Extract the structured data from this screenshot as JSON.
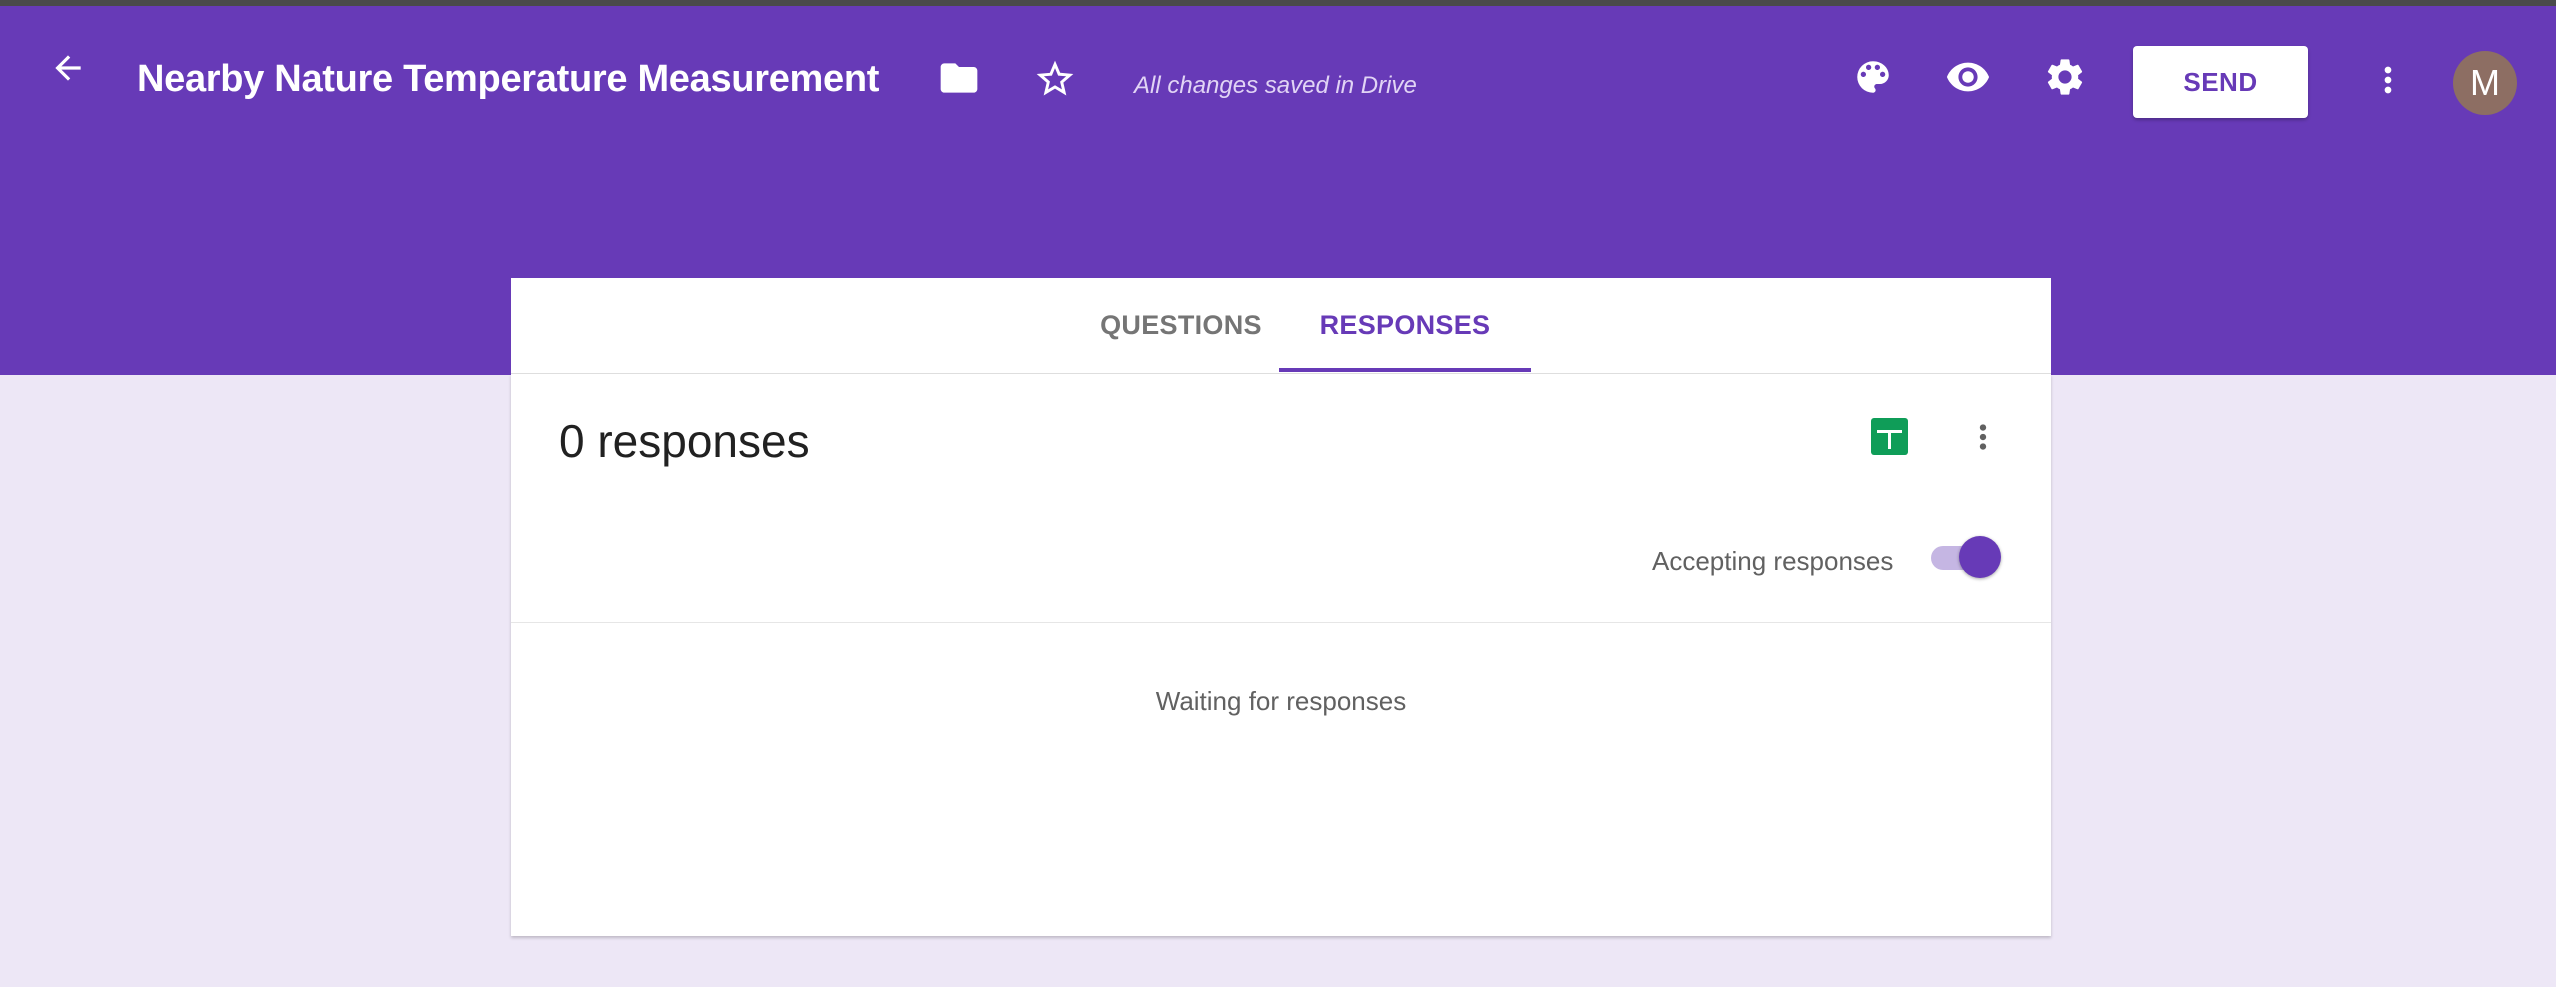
{
  "colors": {
    "brand": "#673ab7",
    "background": "#ede7f6",
    "sheets_green": "#0f9d58",
    "avatar": "#8d6e63"
  },
  "header": {
    "back_icon": "arrow-left-icon",
    "title": "Nearby Nature Temperature Measurement",
    "folder_icon": "folder-icon",
    "star_icon": "star-outline-icon",
    "save_status": "All changes saved in Drive",
    "palette_icon": "palette-icon",
    "preview_icon": "eye-icon",
    "settings_icon": "gear-icon",
    "send_label": "SEND",
    "more_icon": "more-vert-icon",
    "avatar_initial": "M"
  },
  "tabs": [
    {
      "label": "QUESTIONS",
      "active": false
    },
    {
      "label": "RESPONSES",
      "active": true
    }
  ],
  "responses": {
    "count_label": "0 responses",
    "sheets_icon": "google-sheets-icon",
    "more_icon": "more-vert-icon",
    "accepting_label": "Accepting responses",
    "accepting": true,
    "empty_message": "Waiting for responses"
  }
}
